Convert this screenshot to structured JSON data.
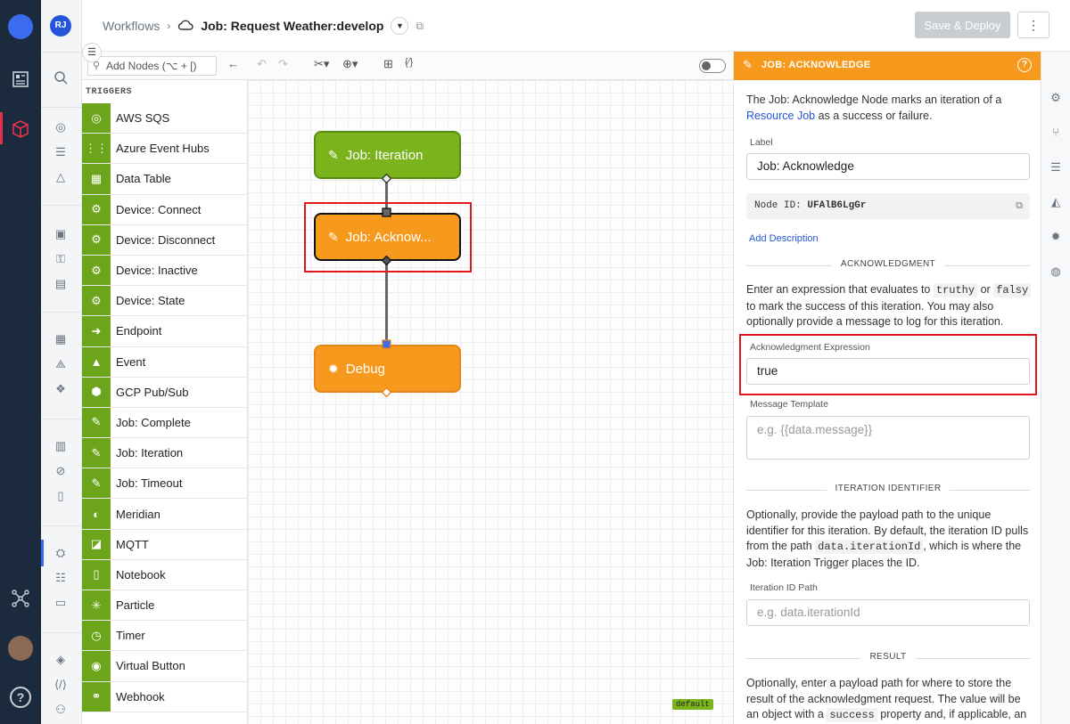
{
  "header": {
    "crumb": "Workflows",
    "title": "Job: Request Weather:develop",
    "save_deploy": "Save & Deploy",
    "kebab": "⋮",
    "user_initials": "RJ"
  },
  "toolbar": {
    "add_nodes_placeholder": "Add Nodes (⌥ + [)"
  },
  "palette": {
    "section": "TRIGGERS",
    "items": [
      {
        "label": "AWS SQS",
        "icon": "aws-sqs-icon",
        "glyph": "◎"
      },
      {
        "label": "Azure Event Hubs",
        "icon": "azure-hub-icon",
        "glyph": "⋮⋮"
      },
      {
        "label": "Data Table",
        "icon": "table-icon",
        "glyph": "▦"
      },
      {
        "label": "Device: Connect",
        "icon": "device-icon",
        "glyph": "⚙"
      },
      {
        "label": "Device: Disconnect",
        "icon": "device-icon",
        "glyph": "⚙"
      },
      {
        "label": "Device: Inactive",
        "icon": "device-icon",
        "glyph": "⚙"
      },
      {
        "label": "Device: State",
        "icon": "device-icon",
        "glyph": "⚙"
      },
      {
        "label": "Endpoint",
        "icon": "endpoint-icon",
        "glyph": "➜"
      },
      {
        "label": "Event",
        "icon": "warning-icon",
        "glyph": "▲"
      },
      {
        "label": "GCP Pub/Sub",
        "icon": "gcp-icon",
        "glyph": "⬢"
      },
      {
        "label": "Job: Complete",
        "icon": "job-icon",
        "glyph": "✎"
      },
      {
        "label": "Job: Iteration",
        "icon": "job-icon",
        "glyph": "✎"
      },
      {
        "label": "Job: Timeout",
        "icon": "job-icon",
        "glyph": "✎"
      },
      {
        "label": "Meridian",
        "icon": "meridian-icon",
        "glyph": "◐"
      },
      {
        "label": "MQTT",
        "icon": "mqtt-icon",
        "glyph": "◪"
      },
      {
        "label": "Notebook",
        "icon": "notebook-icon",
        "glyph": "▯"
      },
      {
        "label": "Particle",
        "icon": "particle-icon",
        "glyph": "✳"
      },
      {
        "label": "Timer",
        "icon": "timer-icon",
        "glyph": "◷"
      },
      {
        "label": "Virtual Button",
        "icon": "button-icon",
        "glyph": "◉"
      },
      {
        "label": "Webhook",
        "icon": "webhook-icon",
        "glyph": "⚭"
      }
    ]
  },
  "canvas": {
    "nodes": {
      "iteration": "Job: Iteration",
      "acknowledge": "Job: Acknow...",
      "debug": "Debug"
    },
    "default_badge": "default"
  },
  "panel": {
    "header": "JOB: ACKNOWLEDGE",
    "intro_1": "The Job: Acknowledge Node marks an iteration of a",
    "intro_link": "Resource Job",
    "intro_2": "as a success or failure.",
    "label_label": "Label",
    "label_value": "Job: Acknowledge",
    "node_id_prefix": "Node ID:",
    "node_id": "UFAlB6LgGr",
    "add_description": "Add Description",
    "section_ack": "ACKNOWLEDGMENT",
    "ack_text_1": "Enter an expression that evaluates to",
    "ack_code_1": "truthy",
    "ack_text_2": "or",
    "ack_code_2": "falsy",
    "ack_text_3": "to mark the success of this iteration. You may also optionally provide a message to log for this iteration.",
    "ack_expr_label": "Acknowledgment Expression",
    "ack_expr_value": "true",
    "msg_label": "Message Template",
    "msg_placeholder": "e.g. {{data.message}}",
    "section_iter": "ITERATION IDENTIFIER",
    "iter_text_1": "Optionally, provide the payload path to the unique identifier for this iteration. By default, the iteration ID pulls from the path",
    "iter_code": "data.iterationId",
    "iter_text_2": ", which is where the Job: Iteration Trigger places the ID.",
    "iter_label": "Iteration ID Path",
    "iter_placeholder": "e.g. data.iterationId",
    "section_result": "RESULT",
    "result_text_1": "Optionally, enter a payload path for where to store the result of the acknowledgment request. The value will be an object with a",
    "result_code": "success",
    "result_text_2": "property and, if applicable, an"
  },
  "colors": {
    "trigger_green": "#7ab31c",
    "node_orange": "#f7991c",
    "selection_red": "#e0181e",
    "nav_dark": "#1b2a3c",
    "link_blue": "#2455d9"
  }
}
